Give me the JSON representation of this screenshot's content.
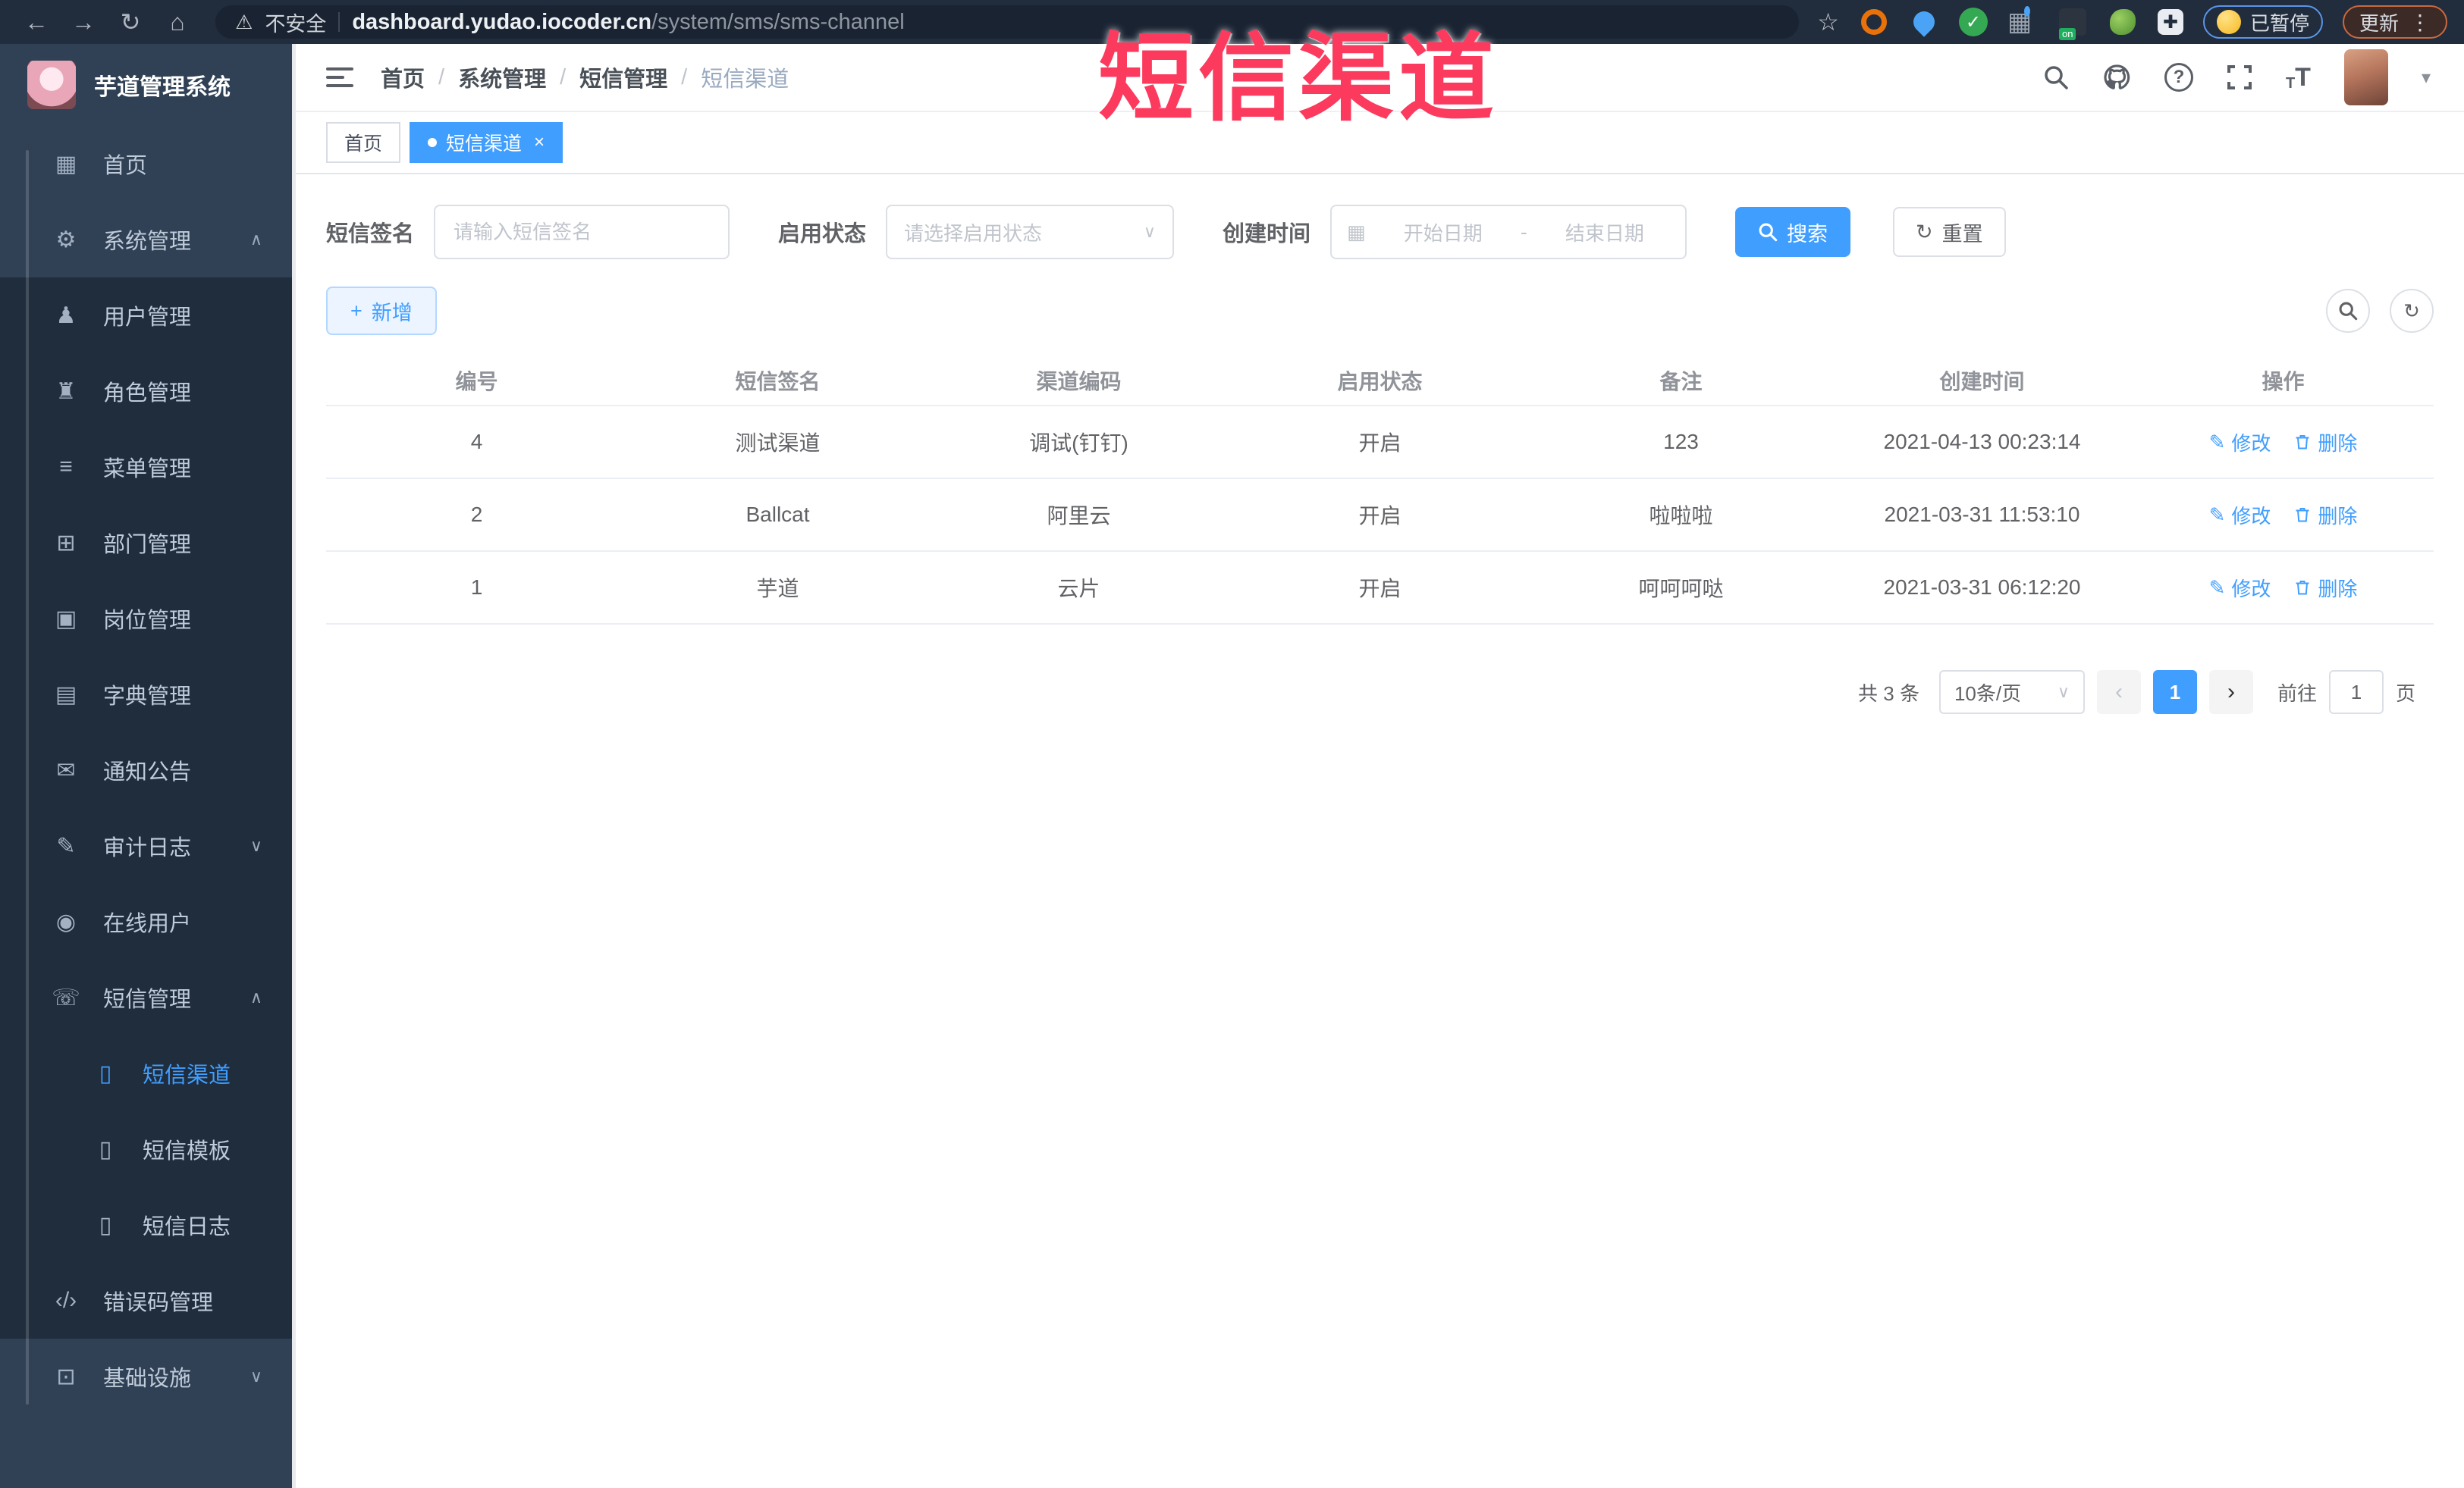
{
  "browser": {
    "security_label": "不安全",
    "url_domain": "dashboard.yudao.iocoder.cn",
    "url_path": "/system/sms/sms-channel",
    "paused_badge": "已暂停",
    "update_button": "更新"
  },
  "overlay": {
    "title": "短信渠道"
  },
  "sidebar": {
    "app_title": "芋道管理系统",
    "items": [
      {
        "label": "首页",
        "icon": "dashboard-icon",
        "level": 1,
        "submenu": false
      },
      {
        "label": "系统管理",
        "icon": "gear-icon",
        "level": 1,
        "submenu": false,
        "chevron": "up"
      },
      {
        "label": "用户管理",
        "icon": "user-icon",
        "level": 2,
        "submenu": true
      },
      {
        "label": "角色管理",
        "icon": "role-icon",
        "level": 2,
        "submenu": true
      },
      {
        "label": "菜单管理",
        "icon": "menu-icon",
        "level": 2,
        "submenu": true
      },
      {
        "label": "部门管理",
        "icon": "dept-icon",
        "level": 2,
        "submenu": true
      },
      {
        "label": "岗位管理",
        "icon": "post-icon",
        "level": 2,
        "submenu": true
      },
      {
        "label": "字典管理",
        "icon": "dict-icon",
        "level": 2,
        "submenu": true
      },
      {
        "label": "通知公告",
        "icon": "notice-icon",
        "level": 2,
        "submenu": true
      },
      {
        "label": "审计日志",
        "icon": "audit-icon",
        "level": 2,
        "submenu": true,
        "chevron": "down"
      },
      {
        "label": "在线用户",
        "icon": "online-icon",
        "level": 2,
        "submenu": true
      },
      {
        "label": "短信管理",
        "icon": "sms-icon",
        "level": 2,
        "submenu": true,
        "chevron": "up"
      },
      {
        "label": "短信渠道",
        "icon": "phone-icon",
        "level": 3,
        "submenu": true,
        "active": true
      },
      {
        "label": "短信模板",
        "icon": "phone-icon",
        "level": 3,
        "submenu": true
      },
      {
        "label": "短信日志",
        "icon": "phone-icon",
        "level": 3,
        "submenu": true
      },
      {
        "label": "错误码管理",
        "icon": "code-icon",
        "level": 2,
        "submenu": true
      },
      {
        "label": "基础设施",
        "icon": "infra-icon",
        "level": 1,
        "submenu": false,
        "chevron": "down"
      }
    ]
  },
  "breadcrumb": {
    "separator": "/",
    "items": [
      "首页",
      "系统管理",
      "短信管理",
      "短信渠道"
    ]
  },
  "tabs": [
    {
      "label": "首页",
      "active": false,
      "closable": false
    },
    {
      "label": "短信渠道",
      "active": true,
      "closable": true
    }
  ],
  "filters": {
    "sign_label": "短信签名",
    "sign_placeholder": "请输入短信签名",
    "status_label": "启用状态",
    "status_placeholder": "请选择启用状态",
    "time_label": "创建时间",
    "start_placeholder": "开始日期",
    "range_separator": "-",
    "end_placeholder": "结束日期",
    "search_label": "搜索",
    "reset_label": "重置"
  },
  "toolbar": {
    "add_label": "新增"
  },
  "table": {
    "headers": [
      "编号",
      "短信签名",
      "渠道编码",
      "启用状态",
      "备注",
      "创建时间",
      "操作"
    ],
    "rows": [
      {
        "id": "4",
        "sign": "测试渠道",
        "code": "调试(钉钉)",
        "status": "开启",
        "remark": "123",
        "created": "2021-04-13 00:23:14"
      },
      {
        "id": "2",
        "sign": "Ballcat",
        "code": "阿里云",
        "status": "开启",
        "remark": "啦啦啦",
        "created": "2021-03-31 11:53:10"
      },
      {
        "id": "1",
        "sign": "芋道",
        "code": "云片",
        "status": "开启",
        "remark": "呵呵呵哒",
        "created": "2021-03-31 06:12:20"
      }
    ],
    "edit_label": "修改",
    "delete_label": "删除"
  },
  "pagination": {
    "total": "共 3 条",
    "page_size": "10条/页",
    "current_page": "1",
    "goto_label": "前往",
    "goto_value": "1",
    "page_unit": "页"
  },
  "icons": {
    "back": "←",
    "forward": "→",
    "reload": "↻",
    "home": "⌂",
    "warning": "⚠",
    "star": "☆",
    "dots": "⋮",
    "caret-down": "▾",
    "chevron-up": "∧",
    "chevron-down": "∨",
    "select-caret": "∨",
    "calendar": "▦",
    "plus": "+",
    "refresh": "↻",
    "edit": "✎",
    "close": "×",
    "prev": "‹",
    "next": "›",
    "puzzle": "✚",
    "check": "✓",
    "grid": "▦",
    "fontsize": "T",
    "dashboard-icon": "▦",
    "gear-icon": "⚙",
    "user-icon": "♟",
    "role-icon": "♜",
    "menu-icon": "≡",
    "dept-icon": "⊞",
    "post-icon": "▣",
    "dict-icon": "▤",
    "notice-icon": "✉",
    "audit-icon": "✎",
    "online-icon": "◉",
    "sms-icon": "☏",
    "phone-icon": "▯",
    "code-icon": "‹/›",
    "infra-icon": "⊡"
  },
  "colors": {
    "accent": "#409EFF",
    "overlay_red": "#fb3a5e",
    "sidebar_bg": "#304156",
    "submenu_bg": "#1f2d3d"
  }
}
